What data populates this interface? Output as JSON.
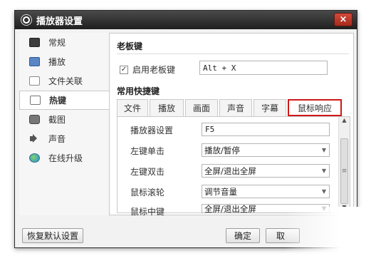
{
  "window": {
    "title": "播放器设置",
    "close": "×"
  },
  "sidebar": {
    "items": [
      {
        "label": "常规",
        "icon": "general-icon"
      },
      {
        "label": "播放",
        "icon": "playback-icon"
      },
      {
        "label": "文件关联",
        "icon": "file-association-icon"
      },
      {
        "label": "热键",
        "icon": "hotkey-icon",
        "active": true
      },
      {
        "label": "截图",
        "icon": "camera-icon"
      },
      {
        "label": "声音",
        "icon": "speaker-icon"
      },
      {
        "label": "在线升级",
        "icon": "globe-update-icon"
      }
    ]
  },
  "boss_key": {
    "title": "老板键",
    "enable_label": "启用老板键",
    "enabled": true,
    "value": "Alt + X"
  },
  "common_hotkeys": {
    "title": "常用快捷键",
    "tabs": [
      "文件",
      "播放",
      "画面",
      "声音",
      "字幕",
      "鼠标响应"
    ],
    "active_tab": "鼠标响应",
    "highlight_color": "#d01818",
    "rows": [
      {
        "label": "播放器设置",
        "value": "F5",
        "kind": "input"
      },
      {
        "label": "左键单击",
        "value": "播放/暂停",
        "kind": "select"
      },
      {
        "label": "左键双击",
        "value": "全屏/退出全屏",
        "kind": "select"
      },
      {
        "label": "鼠标滚轮",
        "value": "调节音量",
        "kind": "select"
      },
      {
        "label": "鼠标中键",
        "value": "全屏/退出全屏",
        "kind": "select"
      }
    ]
  },
  "footer": {
    "restore_label": "恢复默认设置",
    "ok_label": "确定",
    "cancel_label": "取"
  }
}
